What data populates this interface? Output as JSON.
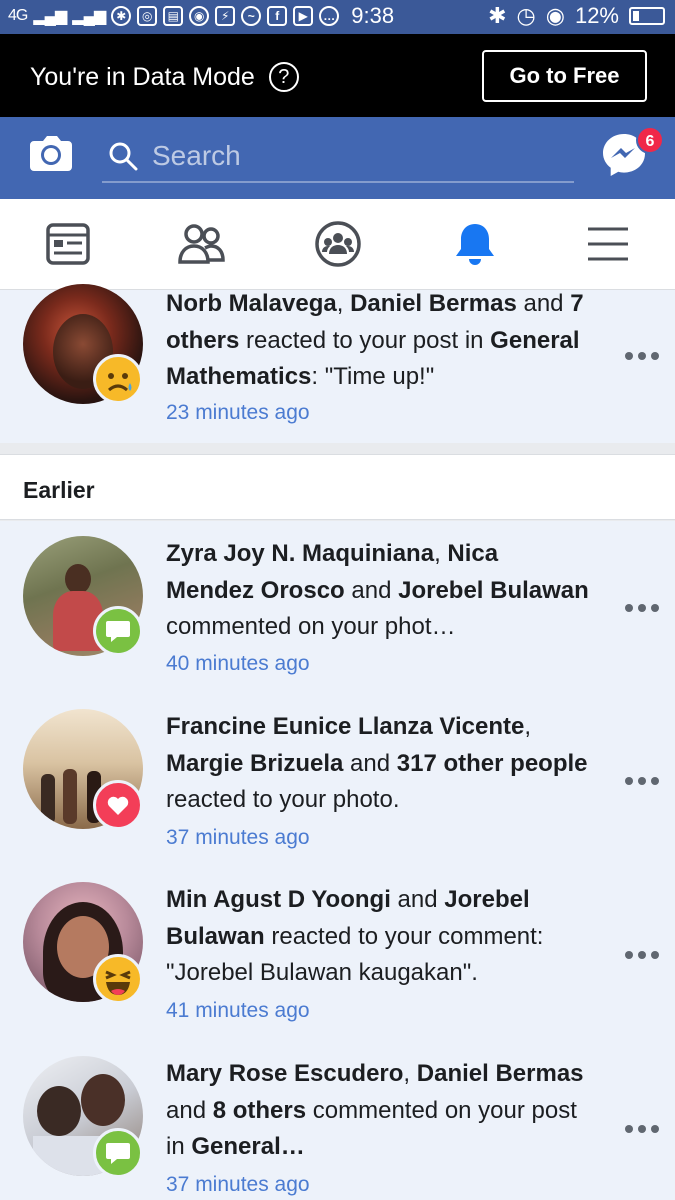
{
  "status_bar": {
    "network": "4G",
    "time": "9:38",
    "battery": "12%"
  },
  "data_mode": {
    "message": "You're in Data Mode",
    "help": "?",
    "button": "Go to Free"
  },
  "search": {
    "placeholder": "Search",
    "messenger_badge": "6"
  },
  "colors": {
    "brand": "#4267b2",
    "status_bar": "#3b5998",
    "unread_bg": "#edf2fa",
    "link_time": "#4b7bd1",
    "active_tab": "#1877f2"
  },
  "tabs": [
    "news-feed",
    "friends",
    "groups",
    "notifications",
    "menu"
  ],
  "notifications_top": [
    {
      "actor1": "Norb Malavega",
      "sep1": ", ",
      "actor2": "Daniel Bermas",
      "sep2": " and ",
      "actor3": "7 others",
      "action": " reacted to your post in ",
      "target": "General Mathematics",
      "suffix": ": \"Time up!\"",
      "time": "23 minutes ago",
      "badge": "sad"
    }
  ],
  "section_title": "Earlier",
  "notifications": [
    {
      "actor1": "Zyra Joy N. Maquiniana",
      "sep1": ", ",
      "actor2": "Nica Mendez Orosco",
      "sep2": " and ",
      "actor3": "Jorebel Bulawan",
      "action": " commented on your phot…",
      "time": "40 minutes ago",
      "badge": "comment"
    },
    {
      "actor1": "Francine Eunice Llanza Vicente",
      "sep1": ", ",
      "actor2": "Margie Brizuela",
      "sep2": " and ",
      "actor3": "317 other people",
      "action": " reacted to your photo.",
      "time": "37 minutes ago",
      "badge": "love"
    },
    {
      "actor1": "Min Agust D Yoongi",
      "sep1": " and ",
      "actor2": "Jorebel Bulawan",
      "action": " reacted to your comment: \"Jorebel Bulawan kaugakan\".",
      "time": "41 minutes ago",
      "badge": "haha"
    },
    {
      "actor1": "Mary Rose Escudero",
      "sep1": ", ",
      "actor2": "Daniel Bermas",
      "sep2": " and ",
      "actor3": "8 others",
      "action": " commented on your post in ",
      "target": "General…",
      "time": "37 minutes ago",
      "badge": "comment"
    }
  ]
}
